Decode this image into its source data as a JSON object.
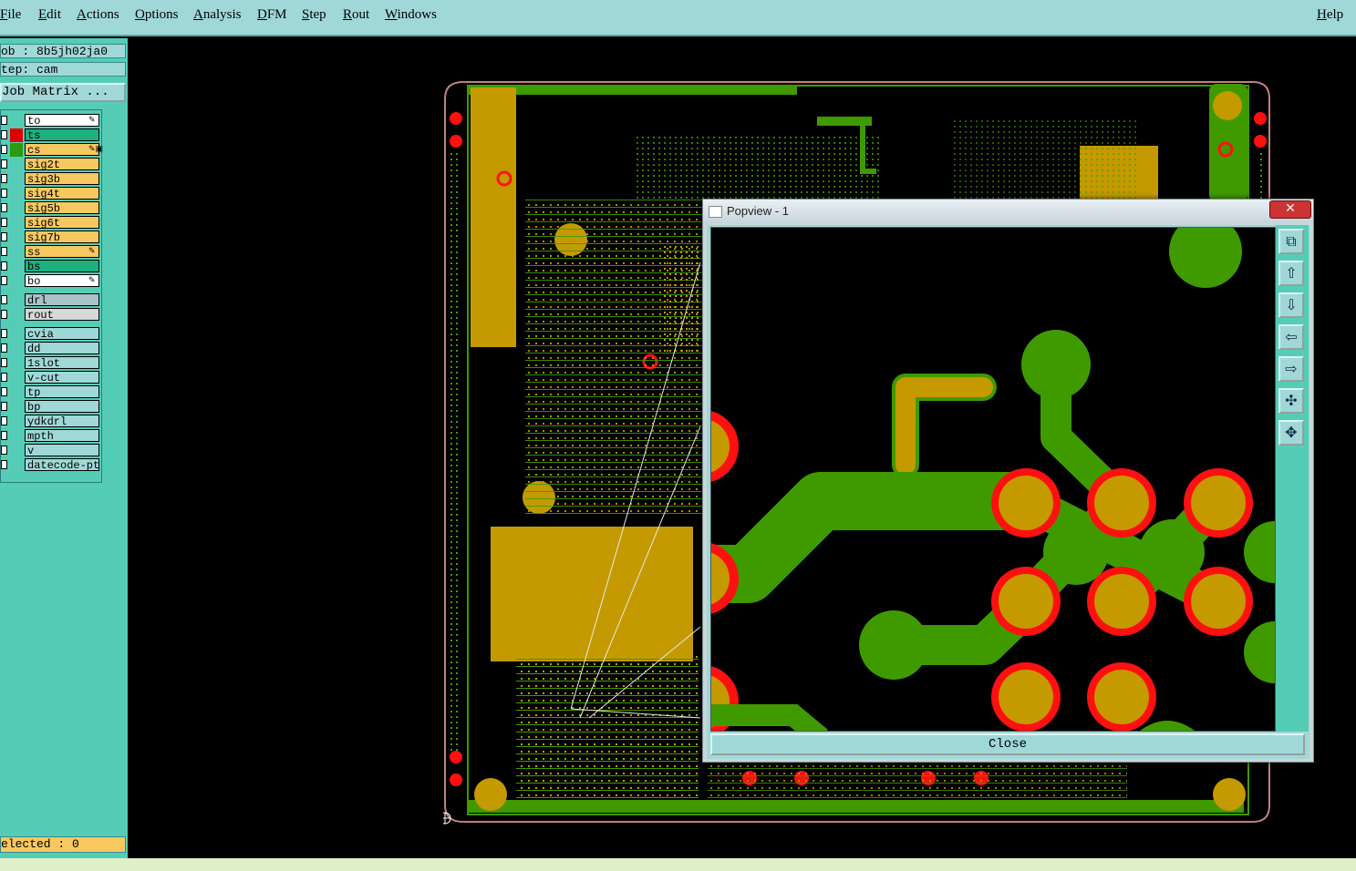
{
  "menubar": {
    "items": [
      "File",
      "Edit",
      "Actions",
      "Options",
      "Analysis",
      "DFM",
      "Step",
      "Rout",
      "Windows"
    ],
    "help": "Help"
  },
  "left": {
    "job": "ob : 8b5jh02ja0",
    "step": "tep: cam",
    "job_matrix": "Job Matrix ...",
    "selected": "elected : 0"
  },
  "layers": [
    {
      "name": "to",
      "bg": "#ffffff",
      "color": "",
      "edit": "✎"
    },
    {
      "name": "ts",
      "bg": "#1bb07e",
      "color": "#e00000",
      "edit": ""
    },
    {
      "name": "cs",
      "bg": "#f7c860",
      "color": "#2a9a10",
      "edit": "✎▣"
    },
    {
      "name": "sig2t",
      "bg": "#f7c860",
      "color": "",
      "edit": ""
    },
    {
      "name": "sig3b",
      "bg": "#f7c860",
      "color": "",
      "edit": ""
    },
    {
      "name": "sig4t",
      "bg": "#f7c860",
      "color": "",
      "edit": ""
    },
    {
      "name": "sig5b",
      "bg": "#f7c860",
      "color": "",
      "edit": ""
    },
    {
      "name": "sig6t",
      "bg": "#f7c860",
      "color": "",
      "edit": ""
    },
    {
      "name": "sig7b",
      "bg": "#f7c860",
      "color": "",
      "edit": ""
    },
    {
      "name": "ss",
      "bg": "#f7c860",
      "color": "",
      "edit": "✎"
    },
    {
      "name": "bs",
      "bg": "#1bb07e",
      "color": "",
      "edit": ""
    },
    {
      "name": "bo",
      "bg": "#ffffff",
      "color": "",
      "edit": "✎"
    },
    {
      "name": "drl",
      "bg": "#a8c4c8",
      "color": "",
      "edit": ""
    },
    {
      "name": "rout",
      "bg": "#d8d8d8",
      "color": "",
      "edit": ""
    },
    {
      "name": "cvia",
      "bg": "#a0d8d8",
      "color": "",
      "edit": ""
    },
    {
      "name": "dd",
      "bg": "#a0d8d8",
      "color": "",
      "edit": ""
    },
    {
      "name": "1slot",
      "bg": "#a0d8d8",
      "color": "",
      "edit": ""
    },
    {
      "name": "v-cut",
      "bg": "#a0d8d8",
      "color": "",
      "edit": ""
    },
    {
      "name": "tp",
      "bg": "#a0d8d8",
      "color": "",
      "edit": ""
    },
    {
      "name": "bp",
      "bg": "#a0d8d8",
      "color": "",
      "edit": ""
    },
    {
      "name": "ydkdrl",
      "bg": "#a0d8d8",
      "color": "",
      "edit": ""
    },
    {
      "name": "mpth",
      "bg": "#a0d8d8",
      "color": "",
      "edit": ""
    },
    {
      "name": "v",
      "bg": "#a0d8d8",
      "color": "",
      "edit": ""
    },
    {
      "name": "datecode-pt",
      "bg": "#a0d8d8",
      "color": "",
      "edit": ""
    }
  ],
  "popview": {
    "title": "Popview - 1",
    "close_x": "✕",
    "close_button": "Close",
    "tools": [
      "zoom-window-icon",
      "zoom-in-icon",
      "zoom-out-icon",
      "pan-left-icon",
      "pan-right-icon",
      "fit-screen-icon",
      "fit-view-icon"
    ]
  },
  "colors": {
    "background": "#000000",
    "copper_green": "#3f9a00",
    "pad_gold": "#c49a00",
    "pad_red": "#ff1010",
    "panel_teal": "#55cdb6",
    "menu_cyan": "#a0d8d8"
  }
}
